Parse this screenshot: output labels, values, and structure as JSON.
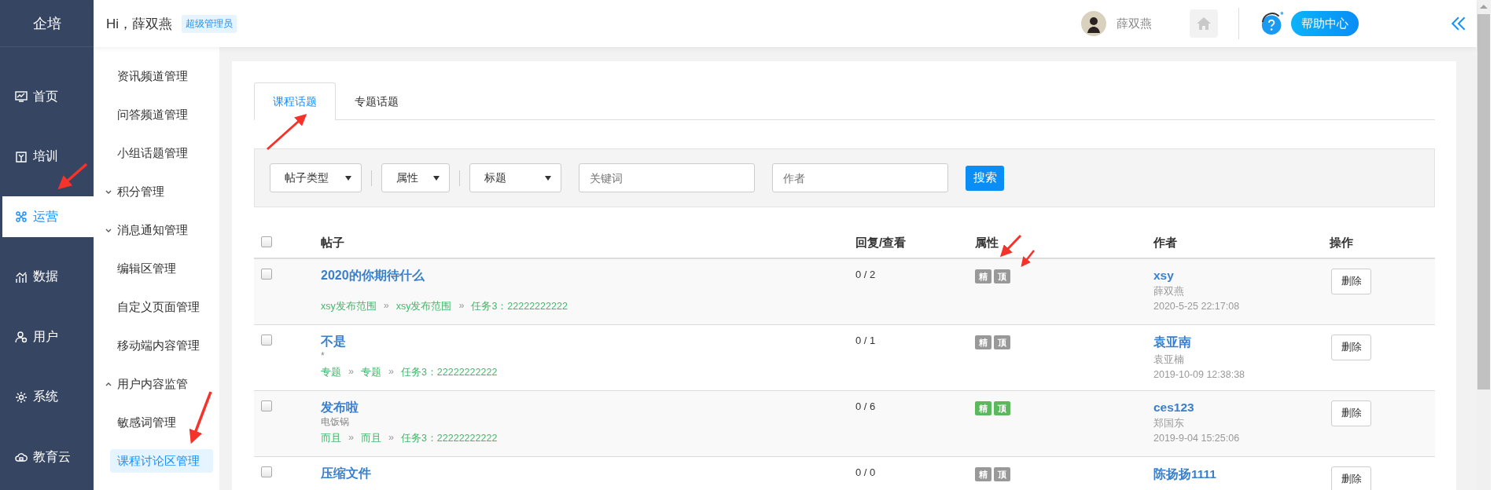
{
  "brand": "企培",
  "nav": [
    {
      "label": "首页",
      "selected": false
    },
    {
      "label": "培训",
      "selected": false
    },
    {
      "label": "运营",
      "selected": true
    },
    {
      "label": "数据",
      "selected": false
    },
    {
      "label": "用户",
      "selected": false
    },
    {
      "label": "系统",
      "selected": false
    },
    {
      "label": "教育云",
      "selected": false
    }
  ],
  "header": {
    "greeting": "Hi，薛双燕",
    "role_badge": "超级管理员",
    "user_name": "薛双燕",
    "help_label": "帮助中心"
  },
  "submenu": [
    {
      "kind": "link",
      "label": "资讯频道管理",
      "selected": false
    },
    {
      "kind": "link",
      "label": "问答频道管理",
      "selected": false
    },
    {
      "kind": "link",
      "label": "小组话题管理",
      "selected": false
    },
    {
      "kind": "group",
      "label": "积分管理",
      "expanded": false
    },
    {
      "kind": "group",
      "label": "消息通知管理",
      "expanded": false
    },
    {
      "kind": "link",
      "label": "编辑区管理",
      "selected": false
    },
    {
      "kind": "link",
      "label": "自定义页面管理",
      "selected": false
    },
    {
      "kind": "link",
      "label": "移动端内容管理",
      "selected": false
    },
    {
      "kind": "group",
      "label": "用户内容监管",
      "expanded": true,
      "children": [
        {
          "label": "敏感词管理",
          "selected": false
        },
        {
          "label": "课程讨论区管理",
          "selected": true
        }
      ]
    }
  ],
  "tabs": [
    {
      "label": "课程话题",
      "selected": true
    },
    {
      "label": "专题话题",
      "selected": false
    }
  ],
  "filters": {
    "selects": [
      "帖子类型",
      "属性",
      "标题"
    ],
    "keyword": {
      "placeholder": "关键词"
    },
    "author": {
      "placeholder": "作者"
    },
    "search_button": "搜索"
  },
  "table": {
    "columns": [
      "帖子",
      "回复/查看",
      "属性",
      "作者",
      "操作"
    ],
    "header_checked": false,
    "path_separator": "»",
    "rows": [
      {
        "checked": false,
        "title": "2020的你期待什么",
        "path": [
          "xsy发布范围",
          "xsy发布范围",
          "任务3：22222222222"
        ],
        "counts": "0 / 2",
        "tags": [
          {
            "label": "精",
            "on": false
          },
          {
            "label": "顶",
            "on": false
          }
        ],
        "author": "xsy",
        "author_name": "薛双燕",
        "date": "2020-5-25 22:17:08",
        "action": "删除"
      },
      {
        "checked": false,
        "title": "不是",
        "excerpt": "*",
        "path": [
          "专题",
          "专题",
          "任务3：22222222222"
        ],
        "counts": "0 / 1",
        "tags": [
          {
            "label": "精",
            "on": false
          },
          {
            "label": "顶",
            "on": false
          }
        ],
        "author": "袁亚南",
        "author_name": "袁亚楠",
        "date": "2019-10-09 12:38:38",
        "action": "删除"
      },
      {
        "checked": false,
        "title": "发布啦",
        "excerpt": "电饭锅",
        "path": [
          "而且",
          "而且",
          "任务3：22222222222"
        ],
        "counts": "0 / 6",
        "tags": [
          {
            "label": "精",
            "on": true
          },
          {
            "label": "顶",
            "on": true
          }
        ],
        "author": "ces123",
        "author_name": "郑国东",
        "date": "2019-9-04 15:25:06",
        "action": "删除"
      },
      {
        "checked": false,
        "title": "压缩文件",
        "counts": "0 / 0",
        "tags": [
          {
            "label": "精",
            "on": false
          },
          {
            "label": "顶",
            "on": false
          }
        ],
        "author": "陈扬扬1111",
        "action": "删除"
      }
    ]
  }
}
